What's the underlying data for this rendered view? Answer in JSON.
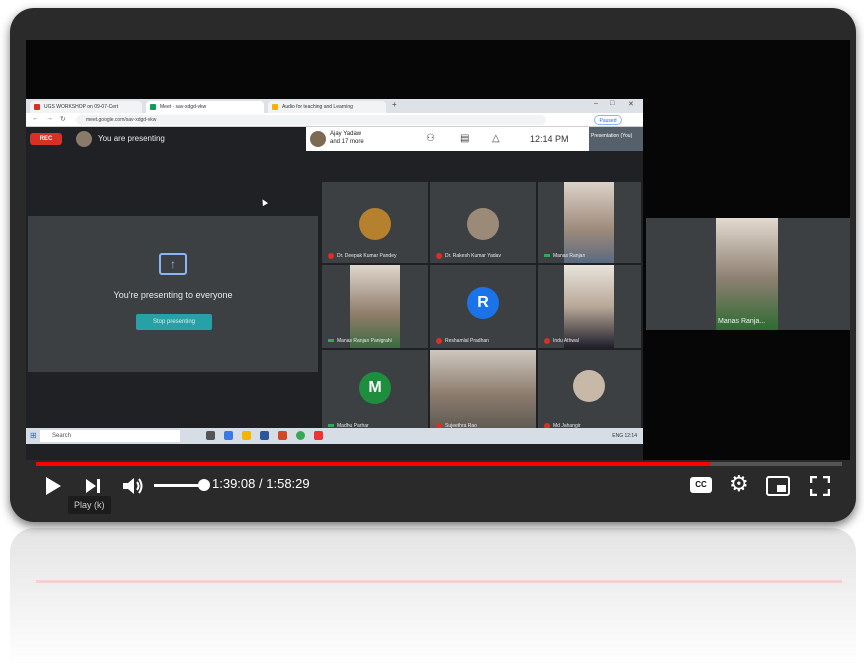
{
  "browser": {
    "tabs": [
      {
        "label": "UGS WORKSHOP on 09-07-Cert",
        "color": "#d93025"
      },
      {
        "label": "Meet - sav-xdgd-vkw",
        "color": "#0f9d58"
      },
      {
        "label": "Audio for teaching and Learning",
        "color": "#f4b400"
      }
    ],
    "url": "meet.google.com/sav-xdgd-vkw",
    "profile_label": "Paused"
  },
  "meet": {
    "rec_label": "REC",
    "presenting_label": "You are presenting",
    "participants_summary_line1": "Ajay Yadaw",
    "participants_summary_line2": "and 17 more",
    "clock": "12:14 PM",
    "mini_thumb_label": "Presentation (You)",
    "present_message": "You're presenting to everyone",
    "stop_button": "Stop presenting",
    "tiles": [
      {
        "name": "Dr. Deepak Kumar Pandey",
        "kind": "avatar"
      },
      {
        "name": "Dr. Rakesh Kumar Yadav",
        "kind": "avatar"
      },
      {
        "name": "Manas Ranjan",
        "kind": "video"
      },
      {
        "name": "Manas Ranjan Panigrahi",
        "kind": "video"
      },
      {
        "name": "Reshamlal Pradhan",
        "kind": "letter",
        "letter": "R",
        "color": "#1a73e8"
      },
      {
        "name": "Indu Athwal",
        "kind": "video"
      },
      {
        "name": "Madhu Parhar",
        "kind": "letter",
        "letter": "M",
        "color": "#1e8e3e"
      },
      {
        "name": "Sujeethra Rao",
        "kind": "video"
      },
      {
        "name": "Md Jahangir",
        "kind": "avatar"
      }
    ],
    "side_tile_name": "Manas Ranja..."
  },
  "taskbar": {
    "search_placeholder": "Search",
    "tray_text": "ENG 12:14"
  },
  "player": {
    "current_time": "1:39:08",
    "separator": "/",
    "duration": "1:58:29",
    "progress_fraction": 0.836,
    "volume_fraction": 0.9,
    "tooltip": "Play (k)",
    "accent": "#ff0000",
    "icons": [
      "play-icon",
      "next-icon",
      "volume-icon",
      "captions-icon",
      "settings-icon",
      "miniplayer-icon",
      "fullscreen-icon"
    ],
    "cc_label": "CC"
  }
}
